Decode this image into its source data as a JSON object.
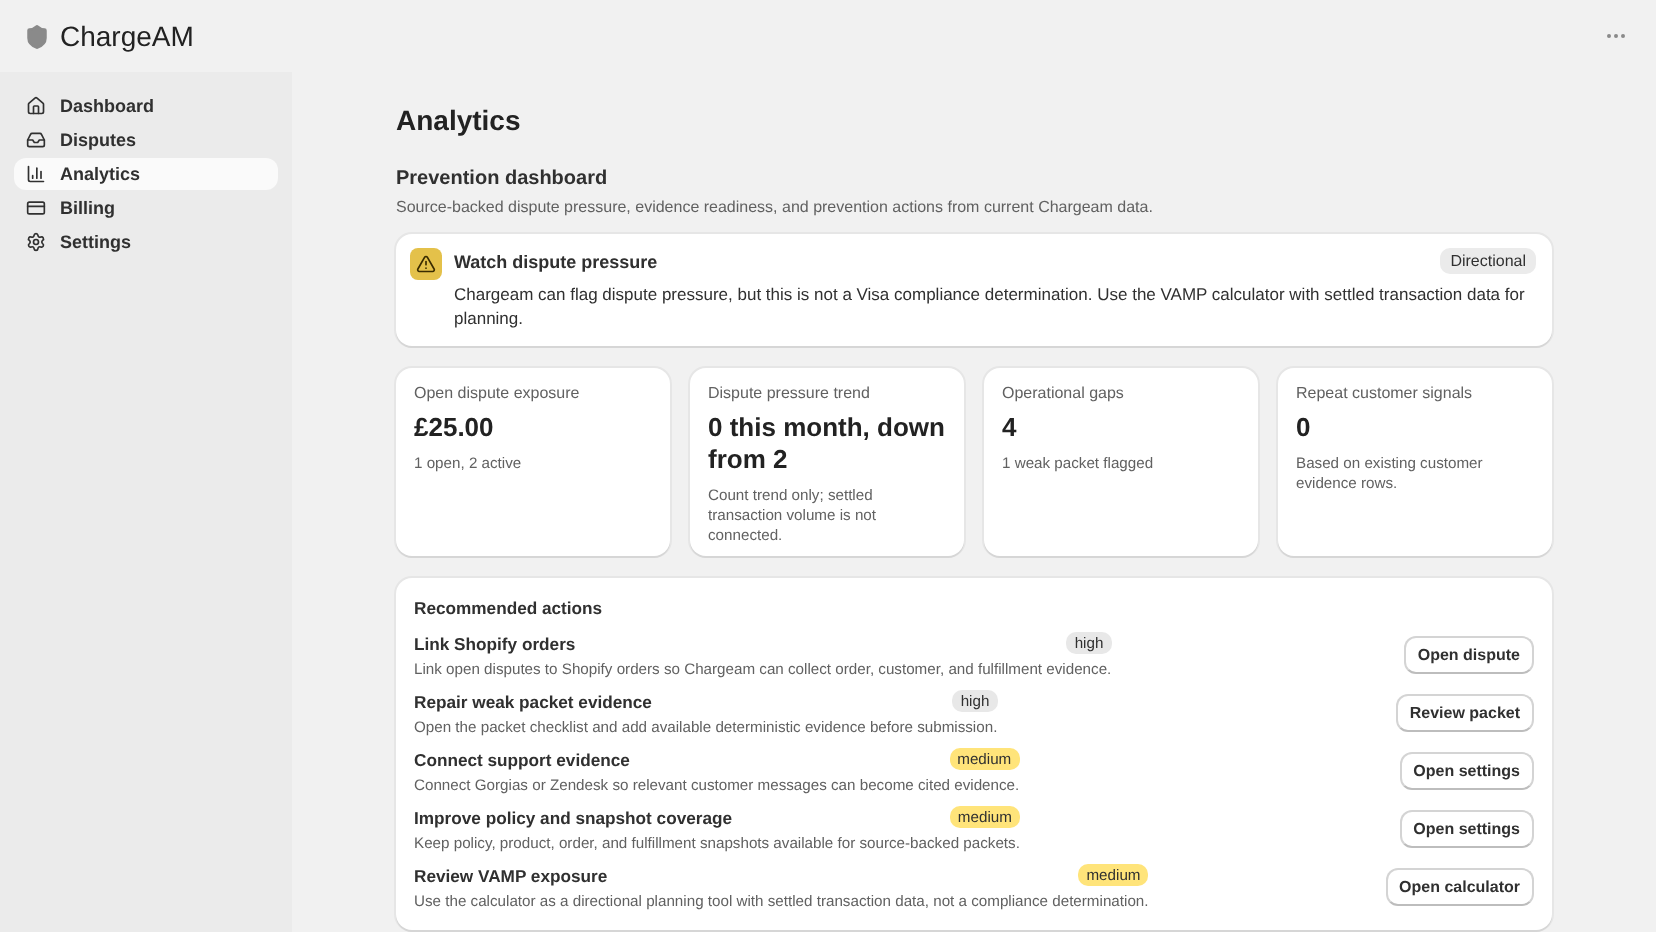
{
  "app": {
    "name": "ChargeAM"
  },
  "sidebar": {
    "items": [
      {
        "label": "Dashboard",
        "selected": false
      },
      {
        "label": "Disputes",
        "selected": false
      },
      {
        "label": "Analytics",
        "selected": true
      },
      {
        "label": "Billing",
        "selected": false
      },
      {
        "label": "Settings",
        "selected": false
      }
    ]
  },
  "page": {
    "title": "Analytics",
    "section_title": "Prevention dashboard",
    "section_subtitle": "Source-backed dispute pressure, evidence readiness, and prevention actions from current Chargeam data."
  },
  "alert": {
    "title": "Watch dispute pressure",
    "badge": "Directional",
    "text": "Chargeam can flag dispute pressure, but this is not a Visa compliance determination. Use the VAMP calculator with settled transaction data for planning."
  },
  "metrics": [
    {
      "label": "Open dispute exposure",
      "value": "£25.00",
      "note": "1 open, 2 active"
    },
    {
      "label": "Dispute pressure trend",
      "value": "0 this month, down from 2",
      "note": "Count trend only; settled transaction volume is not connected."
    },
    {
      "label": "Operational gaps",
      "value": "4",
      "note": "1 weak packet flagged"
    },
    {
      "label": "Repeat customer signals",
      "value": "0",
      "note": "Based on existing customer evidence rows."
    }
  ],
  "actions": {
    "title": "Recommended actions",
    "items": [
      {
        "title": "Link Shopify orders",
        "priority": "high",
        "description": "Link open disputes to Shopify orders so Chargeam can collect order, customer, and fulfillment evidence.",
        "button": "Open dispute"
      },
      {
        "title": "Repair weak packet evidence",
        "priority": "high",
        "description": "Open the packet checklist and add available deterministic evidence before submission.",
        "button": "Review packet"
      },
      {
        "title": "Connect support evidence",
        "priority": "medium",
        "description": "Connect Gorgias or Zendesk so relevant customer messages can become cited evidence.",
        "button": "Open settings"
      },
      {
        "title": "Improve policy and snapshot coverage",
        "priority": "medium",
        "description": "Keep policy, product, order, and fulfillment snapshots available for source-backed packets.",
        "button": "Open settings"
      },
      {
        "title": "Review VAMP exposure",
        "priority": "medium",
        "description": "Use the calculator as a directional planning tool with settled transaction data, not a compliance determination.",
        "button": "Open calculator"
      }
    ]
  }
}
